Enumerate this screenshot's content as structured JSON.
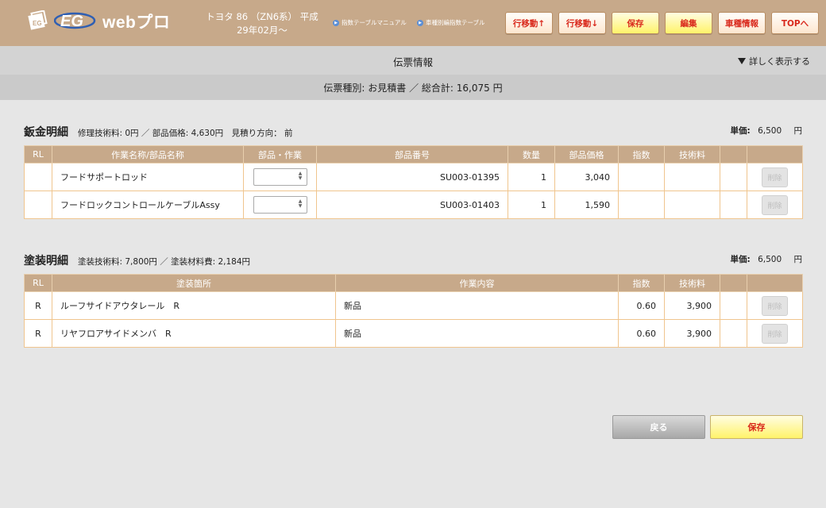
{
  "header": {
    "logo_text": "webプロ",
    "car_info_line1": "トヨタ 86 （ZN6系） 平成",
    "car_info_line2": "29年02月～",
    "link1": "指数テーブルマニュアル",
    "link2": "車種別編指数テーブル",
    "buttons": {
      "row_up": "行移動↑",
      "row_down": "行移動↓",
      "save": "保存",
      "edit": "編集",
      "vehicle_info": "車種情報",
      "top": "TOPへ"
    }
  },
  "slip": {
    "title": "伝票情報",
    "show_more": "詳しく表示する",
    "summary": "伝票種別: お見積書 ／ 総合計: 16,075 円"
  },
  "sheet_metal": {
    "title": "鈑金明細",
    "subtitle": "修理技術料: 0円 ／ 部品価格: 4,630円　見積り方向： 前",
    "unit_label": "単価:",
    "unit_value": "6,500",
    "unit_yen": "円",
    "headers": [
      "RL",
      "作業名称/部品名称",
      "部品・作業",
      "部品番号",
      "数量",
      "部品価格",
      "指数",
      "技術料",
      ""
    ],
    "rows": [
      {
        "rl": "",
        "name": "フードサポートロッド",
        "part_no": "SU003-01395",
        "qty": "1",
        "price": "3,040",
        "index": "",
        "tech_fee": "",
        "delete": "削除"
      },
      {
        "rl": "",
        "name": "フードロックコントロールケーブルAssy",
        "part_no": "SU003-01403",
        "qty": "1",
        "price": "1,590",
        "index": "",
        "tech_fee": "",
        "delete": "削除"
      }
    ]
  },
  "paint": {
    "title": "塗装明細",
    "subtitle": "塗装技術料: 7,800円 ／ 塗装材料費: 2,184円",
    "unit_label": "単価:",
    "unit_value": "6,500",
    "unit_yen": "円",
    "headers": [
      "RL",
      "塗装箇所",
      "作業内容",
      "指数",
      "技術料",
      ""
    ],
    "rows": [
      {
        "rl": "R",
        "place": "ルーフサイドアウタレール　R",
        "work": "新品",
        "index": "0.60",
        "tech_fee": "3,900",
        "delete": "削除"
      },
      {
        "rl": "R",
        "place": "リヤフロアサイドメンバ　R",
        "work": "新品",
        "index": "0.60",
        "tech_fee": "3,900",
        "delete": "削除"
      }
    ]
  },
  "footer": {
    "back": "戻る",
    "save": "保存"
  }
}
